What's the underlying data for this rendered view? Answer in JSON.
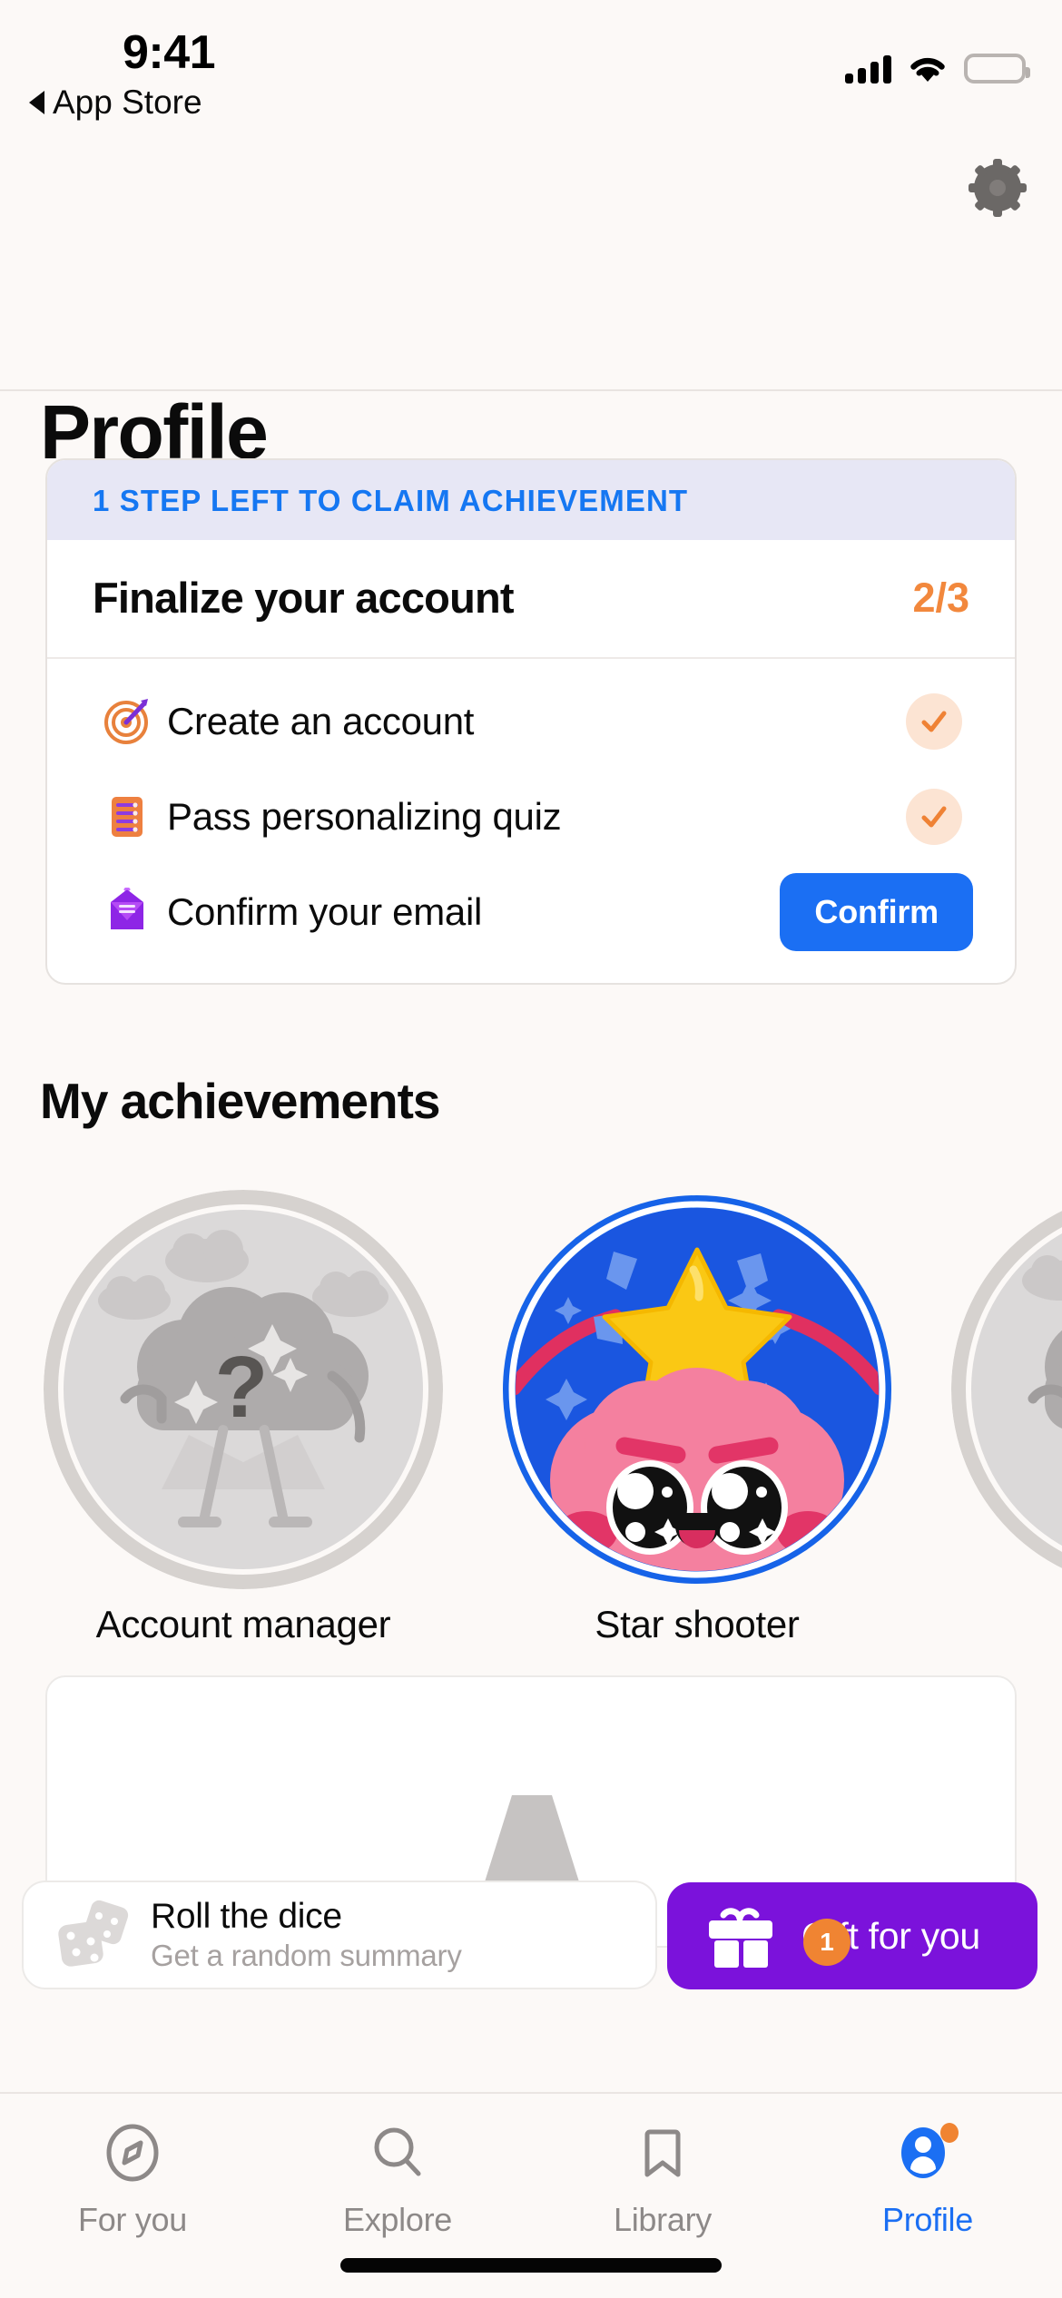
{
  "status_bar": {
    "time": "9:41",
    "back_label": "App Store",
    "back_icon": "triangle-left-icon",
    "cellular_icon": "cellular-signal-icon",
    "wifi_icon": "wifi-icon",
    "battery_icon": "battery-full-icon"
  },
  "header": {
    "title": "Profile",
    "settings_icon": "gear-icon"
  },
  "checklist_card": {
    "banner": "1 STEP LEFT TO CLAIM ACHIEVEMENT",
    "banner_color": "#1577F2",
    "banner_bg": "#E7E7F5",
    "title": "Finalize your account",
    "count": "2/3",
    "count_color": "#F2883D",
    "steps": [
      {
        "icon": "target-dart-icon",
        "label": "Create an account",
        "state": "done",
        "check_icon": "check-icon"
      },
      {
        "icon": "quiz-list-icon",
        "label": "Pass personalizing quiz",
        "state": "done",
        "check_icon": "check-icon"
      },
      {
        "icon": "email-envelope-icon",
        "label": "Confirm your email",
        "state": "pending",
        "action_label": "Confirm",
        "action_color": "#1B6FF3"
      }
    ]
  },
  "achievements": {
    "section_title": "My achievements",
    "items": [
      {
        "name": "Account manager",
        "locked": true,
        "icon": "locked-cloud-question-badge"
      },
      {
        "name": "Star shooter",
        "locked": false,
        "icon": "star-character-badge"
      },
      {
        "name": "",
        "locked": true,
        "icon": "locked-cloud-question-badge"
      }
    ]
  },
  "float_bar": {
    "dice": {
      "icon": "dice-icon",
      "title": "Roll the dice",
      "subtitle": "Get a random summary"
    },
    "gift": {
      "icon": "gift-icon",
      "label": "Gift for you",
      "badge_count": "1",
      "bg": "#7B12DB",
      "badge_bg": "#F08432"
    }
  },
  "tab_bar": {
    "active": "Profile",
    "accent": "#1B6FF3",
    "tabs": [
      {
        "label": "For you",
        "icon": "compass-icon",
        "active": false
      },
      {
        "label": "Explore",
        "icon": "search-icon",
        "active": false
      },
      {
        "label": "Library",
        "icon": "bookmark-icon",
        "active": false
      },
      {
        "label": "Profile",
        "icon": "person-icon",
        "active": true
      }
    ]
  }
}
